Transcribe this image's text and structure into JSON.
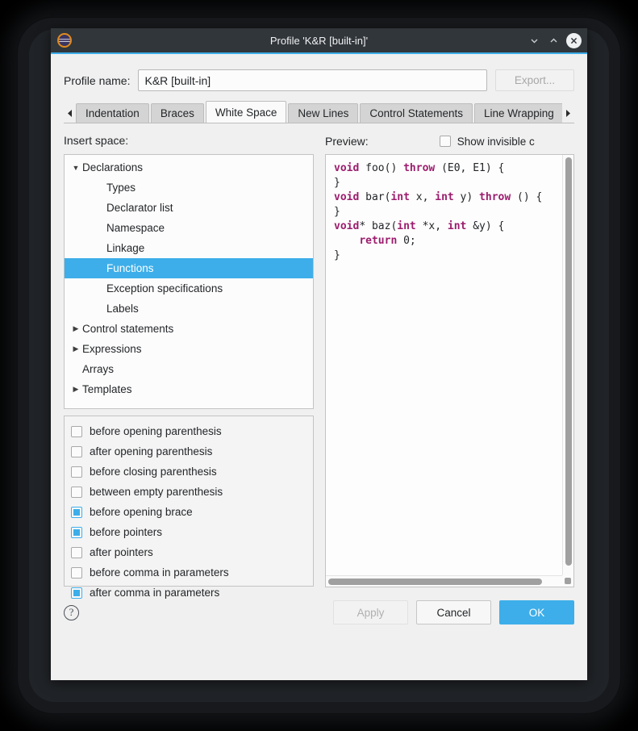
{
  "window": {
    "title": "Profile 'K&R [built-in]'",
    "app_icon": "eclipse-icon",
    "minimize_icon": "chevron-down-icon",
    "maximize_icon": "chevron-up-icon",
    "close_icon": "close-icon"
  },
  "profile": {
    "label": "Profile name:",
    "value": "K&R [built-in]",
    "export_label": "Export..."
  },
  "tabs": {
    "scroll_left_icon": "triangle-left-icon",
    "scroll_right_icon": "triangle-right-icon",
    "items": [
      {
        "label": "Indentation",
        "active": false
      },
      {
        "label": "Braces",
        "active": false
      },
      {
        "label": "White Space",
        "active": true
      },
      {
        "label": "New Lines",
        "active": false
      },
      {
        "label": "Control Statements",
        "active": false
      },
      {
        "label": "Line Wrapping",
        "active": false
      }
    ]
  },
  "left": {
    "label": "Insert space:",
    "tree": [
      {
        "label": "Declarations",
        "level": 0,
        "twisty": "expanded",
        "selected": false
      },
      {
        "label": "Types",
        "level": 1,
        "twisty": "none",
        "selected": false
      },
      {
        "label": "Declarator list",
        "level": 1,
        "twisty": "none",
        "selected": false
      },
      {
        "label": "Namespace",
        "level": 1,
        "twisty": "none",
        "selected": false
      },
      {
        "label": "Linkage",
        "level": 1,
        "twisty": "none",
        "selected": false
      },
      {
        "label": "Functions",
        "level": 1,
        "twisty": "none",
        "selected": true
      },
      {
        "label": "Exception specifications",
        "level": 1,
        "twisty": "none",
        "selected": false
      },
      {
        "label": "Labels",
        "level": 1,
        "twisty": "none",
        "selected": false
      },
      {
        "label": "Control statements",
        "level": 0,
        "twisty": "collapsed",
        "selected": false
      },
      {
        "label": "Expressions",
        "level": 0,
        "twisty": "collapsed",
        "selected": false
      },
      {
        "label": "Arrays",
        "level": 0,
        "twisty": "none",
        "selected": false
      },
      {
        "label": "Templates",
        "level": 0,
        "twisty": "collapsed",
        "selected": false
      }
    ],
    "options": [
      {
        "label": "before opening parenthesis",
        "checked": false
      },
      {
        "label": "after opening parenthesis",
        "checked": false
      },
      {
        "label": "before closing parenthesis",
        "checked": false
      },
      {
        "label": "between empty parenthesis",
        "checked": false
      },
      {
        "label": "before opening brace",
        "checked": true
      },
      {
        "label": "before pointers",
        "checked": true
      },
      {
        "label": "after pointers",
        "checked": false
      },
      {
        "label": "before comma in parameters",
        "checked": false
      },
      {
        "label": "after comma in parameters",
        "checked": true
      }
    ]
  },
  "right": {
    "label": "Preview:",
    "show_invisible_label": "Show invisible c",
    "show_invisible_checked": false,
    "code_lines": [
      [
        {
          "t": "void",
          "k": true
        },
        {
          "t": " foo() ",
          "k": false
        },
        {
          "t": "throw",
          "k": true
        },
        {
          "t": " (E0, E1) {",
          "k": false
        }
      ],
      [
        {
          "t": "}",
          "k": false
        }
      ],
      [
        {
          "t": "void",
          "k": true
        },
        {
          "t": " bar(",
          "k": false
        },
        {
          "t": "int",
          "k": true
        },
        {
          "t": " x, ",
          "k": false
        },
        {
          "t": "int",
          "k": true
        },
        {
          "t": " y) ",
          "k": false
        },
        {
          "t": "throw",
          "k": true
        },
        {
          "t": " () {",
          "k": false
        }
      ],
      [
        {
          "t": "}",
          "k": false
        }
      ],
      [
        {
          "t": "void",
          "k": true
        },
        {
          "t": "* baz(",
          "k": false
        },
        {
          "t": "int",
          "k": true
        },
        {
          "t": " *x, ",
          "k": false
        },
        {
          "t": "int",
          "k": true
        },
        {
          "t": " &y) {",
          "k": false
        }
      ],
      [
        {
          "t": "    ",
          "k": false
        },
        {
          "t": "return",
          "k": true
        },
        {
          "t": " 0;",
          "k": false
        }
      ],
      [
        {
          "t": "}",
          "k": false
        }
      ]
    ]
  },
  "footer": {
    "help_label": "?",
    "apply_label": "Apply",
    "apply_enabled": false,
    "cancel_label": "Cancel",
    "ok_label": "OK"
  },
  "colors": {
    "accent": "#3daee9",
    "titlebar": "#31363b",
    "keyword": "#9c1d6e"
  }
}
